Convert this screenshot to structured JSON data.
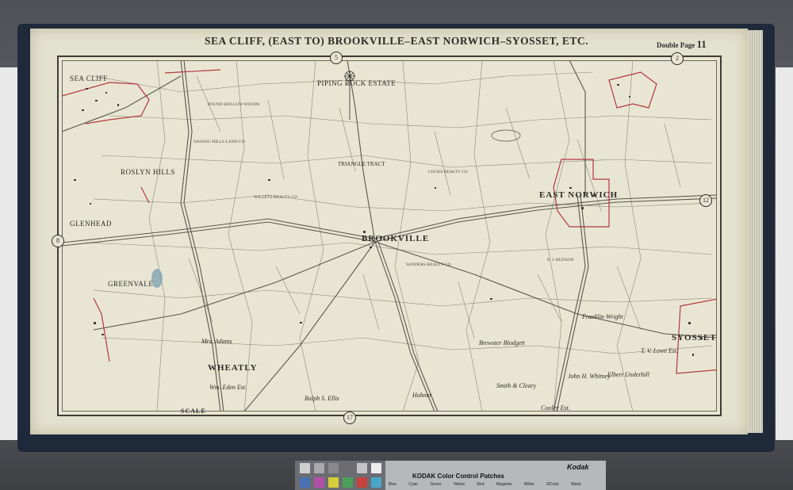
{
  "title": "SEA CLIFF, (EAST TO) BROOKVILLE–EAST NORWICH–SYOSSET, ETC.",
  "page_label": "Double Page",
  "page_number": "11",
  "sheet_refs": {
    "top": "5",
    "top_right": "2",
    "left": "8",
    "right": "12",
    "bottom": "17"
  },
  "places": {
    "piping_rock": "PIPING ROCK ESTATE",
    "brookville": "BROOKVILLE",
    "east_norwich": "EAST NORWICH",
    "syosset": "SYOSSET",
    "wheatly": "WHEATLY",
    "greenvale": "GREENVALE",
    "glen_head": "GLENHEAD",
    "sea_cliff": "SEA CLIFF",
    "roslyn_hills": "ROSLYN HILLS",
    "triangle_tract": "TRIANGLE TRACT"
  },
  "owners": {
    "pound_hollow": "POUND HOLLOW WOODS",
    "nassau_hills": "NASSAU HILLS LAND CO",
    "cocks_realty": "COCKS REALTY CO",
    "willets_realty": "WILLETS REALTY CO",
    "sanders_realty": "SANDERS REALTY CO",
    "hudson": "E. I. HUDSON",
    "brewster": "Brewster Blodgett",
    "tt_lowe": "T. V. Lowe Est.",
    "elbert": "Elbert Underhill",
    "john_whitney": "John H. Whitney",
    "ralph_ellis": "Ralph S. Ellis",
    "franklin_wright": "Franklin Wright",
    "mr_adams": "Mrs. Adams",
    "wm_eden": "Wm. Eden Est.",
    "smith": "Smith & Cleary",
    "hohner": "Hohner",
    "cooley": "Cooley Est."
  },
  "scale_label": "SCALE",
  "kodak": {
    "brand": "Kodak",
    "title": "KODAK Color Control Patches",
    "patch_names": "Blue Cyan Green Yellow Red Magenta White 3/Color Black"
  },
  "colors": {
    "paper": "#e3e2cf",
    "boundary_red": "#b3373f",
    "ink": "#2b2a26",
    "pond": "#7fa3b5"
  }
}
